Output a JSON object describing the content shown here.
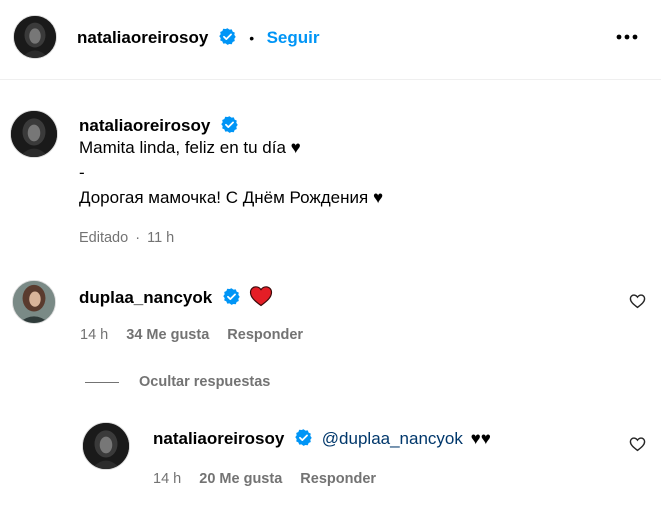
{
  "header": {
    "username": "nataliaoreirosoy",
    "separator": "•",
    "follow_label": "Seguir",
    "more_icon": "more-horizontal-icon"
  },
  "caption": {
    "username": "nataliaoreirosoy",
    "lines": [
      "Mamita linda, feliz en tu día ♥",
      "-",
      "Дорогая мамочка! С Днём Рождения ♥"
    ],
    "edited_label": "Editado",
    "separator": "·",
    "time": "11 h"
  },
  "comments": [
    {
      "username": "duplaa_nancyok",
      "text": "",
      "emoji_icon": "red-heart-icon",
      "time": "14 h",
      "likes_label": "34 Me gusta",
      "reply_label": "Responder",
      "like_icon": "heart-outline-icon"
    }
  ],
  "replies_toggle": {
    "label": "Ocultar respuestas"
  },
  "replies": [
    {
      "username": "nataliaoreirosoy",
      "mention": "@duplaa_nancyok",
      "text": "♥♥",
      "time": "14 h",
      "likes_label": "20 Me gusta",
      "reply_label": "Responder",
      "like_icon": "heart-outline-icon"
    }
  ],
  "colors": {
    "accent": "#0095f6",
    "verified": "#0095f6",
    "muted": "#737373",
    "mention": "#00376b",
    "heart": "#e0245e"
  }
}
